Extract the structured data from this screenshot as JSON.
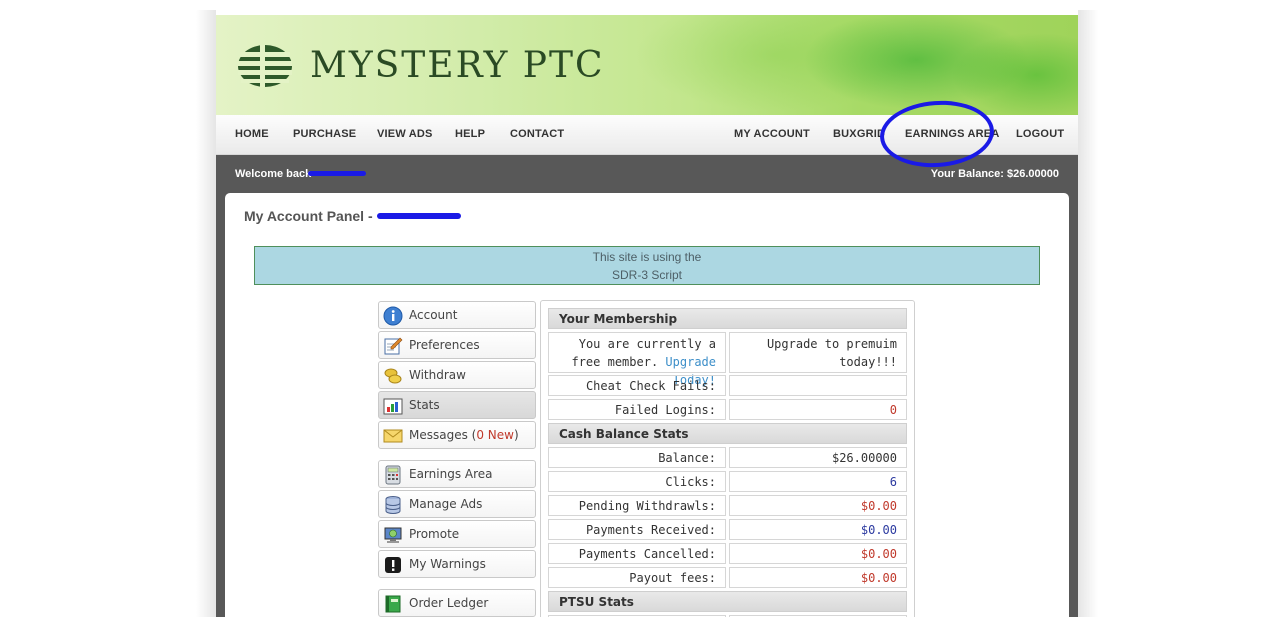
{
  "site": {
    "name": "MYSTERY PTC"
  },
  "nav": {
    "left": [
      "HOME",
      "PURCHASE",
      "VIEW ADS",
      "HELP",
      "CONTACT"
    ],
    "right": [
      "MY ACCOUNT",
      "BUXGRID",
      "EARNINGS AREA",
      "LOGOUT"
    ]
  },
  "welcome": {
    "text": "Welcome back",
    "balance": "Your Balance: $26.00000"
  },
  "panel": {
    "title": "My Account Panel - "
  },
  "notice": {
    "line1": "This site is using the",
    "line2": "SDR-3 Script"
  },
  "menu": {
    "account": "Account",
    "preferences": "Preferences",
    "withdraw": "Withdraw",
    "stats": "Stats",
    "messages": "Messages",
    "messages_new": "0 New",
    "earnings_area": "Earnings Area",
    "manage_ads": "Manage Ads",
    "promote": "Promote",
    "my_warnings": "My Warnings",
    "order_ledger": "Order Ledger"
  },
  "stats": {
    "membership": {
      "heading": "Your Membership",
      "free_text": "You are currently a free member.",
      "upgrade_link": "Upgrade Today!",
      "upgrade_text": "Upgrade to premuim today!!!",
      "cheat_label": "Cheat Check Fails:",
      "cheat_value": "",
      "failed_label": "Failed Logins:",
      "failed_value": "0"
    },
    "cash": {
      "heading": "Cash Balance Stats",
      "rows": [
        {
          "label": "Balance:",
          "value": "$26.00000"
        },
        {
          "label": "Clicks:",
          "value": "6"
        },
        {
          "label": "Pending Withdrawls:",
          "value": "$0.00"
        },
        {
          "label": "Payments Received:",
          "value": "$0.00"
        },
        {
          "label": "Payments Cancelled:",
          "value": "$0.00"
        },
        {
          "label": "Payout fees:",
          "value": "$0.00"
        }
      ]
    },
    "ptsu": {
      "heading": "PTSU Stats"
    }
  },
  "colors": {
    "annotation_blue": "#1a1ae6",
    "notice_bg": "#acd7e2",
    "header_green": "#9fd35a"
  },
  "icons": {
    "account": "info-icon",
    "preferences": "notepad-pencil-icon",
    "withdraw": "coins-icon",
    "stats": "bar-chart-icon",
    "messages": "envelope-icon",
    "earnings_area": "calculator-icon",
    "manage_ads": "database-icon",
    "promote": "monitor-globe-icon",
    "my_warnings": "exclamation-icon",
    "order_ledger": "ledger-book-icon"
  }
}
